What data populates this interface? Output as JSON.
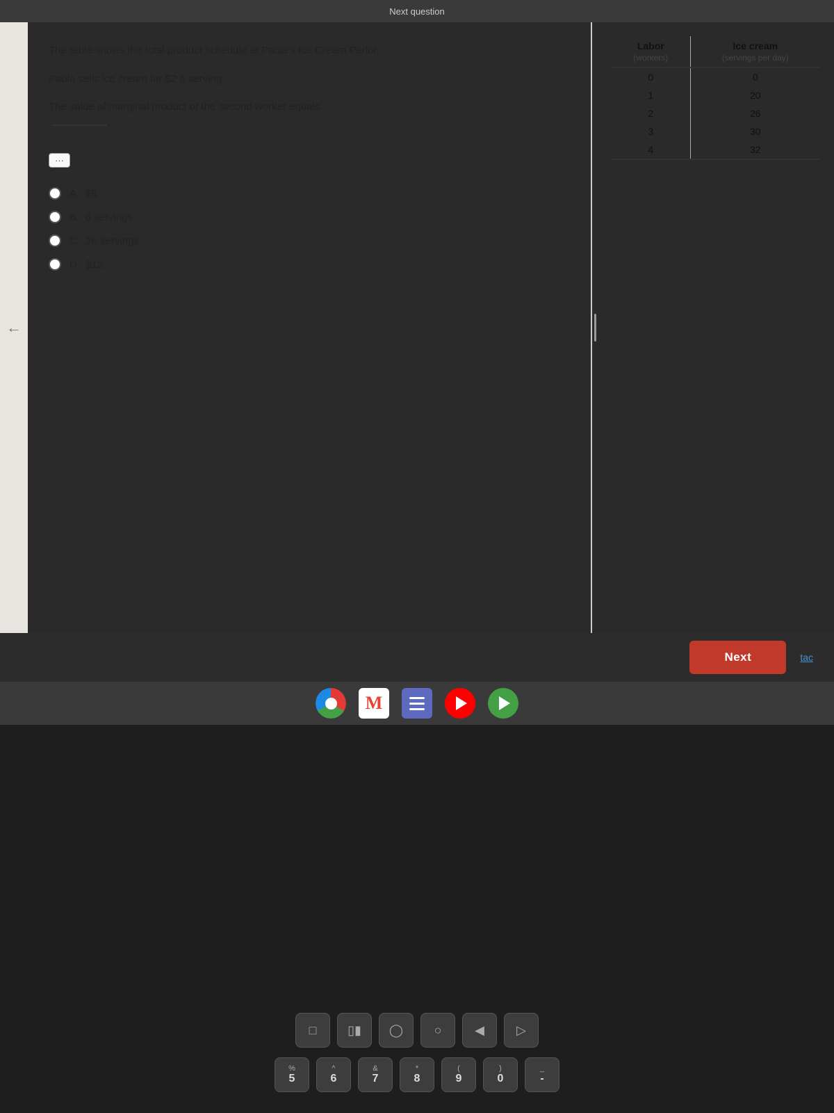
{
  "screen": {
    "topbar_label": "Next question"
  },
  "quiz": {
    "question_main": "The table shows the total product schedule at Paula's Ice Cream Parlor.",
    "question_sub1": "Paula sells ice cream for $2 a serving.",
    "question_sub2": "The value of marginal product of the second worker equals",
    "blank_placeholder": "______",
    "dots_label": "···",
    "options": [
      {
        "label": "A.",
        "value": "$8"
      },
      {
        "label": "B.",
        "value": "6 servings"
      },
      {
        "label": "C.",
        "value": "26 servings"
      },
      {
        "label": "D.",
        "value": "$12"
      }
    ],
    "table": {
      "col1_header": "Labor",
      "col1_sub": "(workers)",
      "col2_header": "Ice cream",
      "col2_sub": "(servings per day)",
      "rows": [
        {
          "labor": "0",
          "ice_cream": "0"
        },
        {
          "labor": "1",
          "ice_cream": "20"
        },
        {
          "labor": "2",
          "ice_cream": "26"
        },
        {
          "labor": "3",
          "ice_cream": "30"
        },
        {
          "labor": "4",
          "ice_cream": "32"
        }
      ]
    }
  },
  "bottom": {
    "next_label": "Next",
    "tab_label": "tac"
  },
  "taskbar": {
    "icons": [
      "chrome",
      "gmail",
      "menu",
      "youtube",
      "play"
    ]
  },
  "keyboard": {
    "row1": [
      {
        "top": "",
        "bottom": "⊡",
        "type": "icon"
      },
      {
        "top": "",
        "bottom": "⊟",
        "type": "icon"
      },
      {
        "top": "",
        "bottom": "○",
        "type": "icon"
      },
      {
        "top": "",
        "bottom": "○",
        "type": "icon"
      },
      {
        "top": "",
        "bottom": "◀",
        "type": "icon"
      },
      {
        "top": "",
        "bottom": "◁",
        "type": "icon"
      }
    ],
    "row2": [
      {
        "top": "%",
        "bottom": "5"
      },
      {
        "top": "^",
        "bottom": "6"
      },
      {
        "top": "&",
        "bottom": "7"
      },
      {
        "top": "*",
        "bottom": "8"
      },
      {
        "top": "(",
        "bottom": "9"
      },
      {
        "top": ")",
        "bottom": "0"
      },
      {
        "top": "_",
        "bottom": "-"
      }
    ]
  }
}
